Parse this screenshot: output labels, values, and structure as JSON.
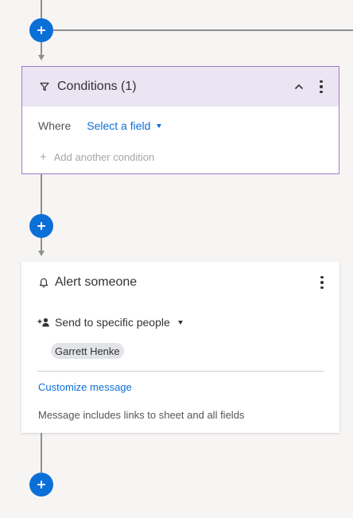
{
  "conditions": {
    "title": "Conditions (1)",
    "where_label": "Where",
    "select_field_label": "Select a field",
    "add_condition_label": "Add another condition"
  },
  "alert": {
    "title": "Alert someone",
    "send_to_label": "Send to specific people",
    "recipient": "Garrett Henke",
    "customize_label": "Customize message",
    "note": "Message includes links to sheet and all fields"
  },
  "colors": {
    "accent": "#0b6fd8",
    "conditions_border": "#a479c8",
    "conditions_header_bg": "#ebe4f2",
    "connector": "#8f8f8f"
  }
}
